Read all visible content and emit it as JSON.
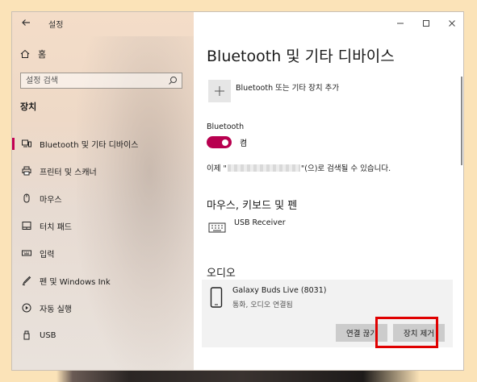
{
  "window": {
    "title": "설정"
  },
  "sidebar": {
    "home_label": "홈",
    "search_placeholder": "설정 검색",
    "section": "장치",
    "items": [
      {
        "label": "Bluetooth 및 기타 디바이스",
        "icon": "bluetooth-devices-icon"
      },
      {
        "label": "프린터 및 스캐너",
        "icon": "printer-icon"
      },
      {
        "label": "마우스",
        "icon": "mouse-icon"
      },
      {
        "label": "터치 패드",
        "icon": "touchpad-icon"
      },
      {
        "label": "입력",
        "icon": "keyboard-icon"
      },
      {
        "label": "펜 및 Windows Ink",
        "icon": "pen-icon"
      },
      {
        "label": "자동 실행",
        "icon": "autoplay-icon"
      },
      {
        "label": "USB",
        "icon": "usb-icon"
      }
    ]
  },
  "main": {
    "title": "Bluetooth 및 기타 디바이스",
    "add_device_label": "Bluetooth 또는 기타 장치 추가",
    "bluetooth_label": "Bluetooth",
    "toggle_state": "켬",
    "discover_prefix": "이제 \"",
    "discover_suffix": "\"(으)로 검색될 수 있습니다.",
    "input_section": "마우스, 키보드 및 펜",
    "input_device": "USB Receiver",
    "audio_section": "오디오",
    "audio_device_name": "Galaxy Buds Live (8031)",
    "audio_device_status": "통화, 오디오 연결됨",
    "disconnect_label": "연결 끊기",
    "remove_label": "장치 제거"
  },
  "colors": {
    "accent": "#c30052",
    "toggle_on": "#b8004f",
    "highlight": "#e00000"
  }
}
